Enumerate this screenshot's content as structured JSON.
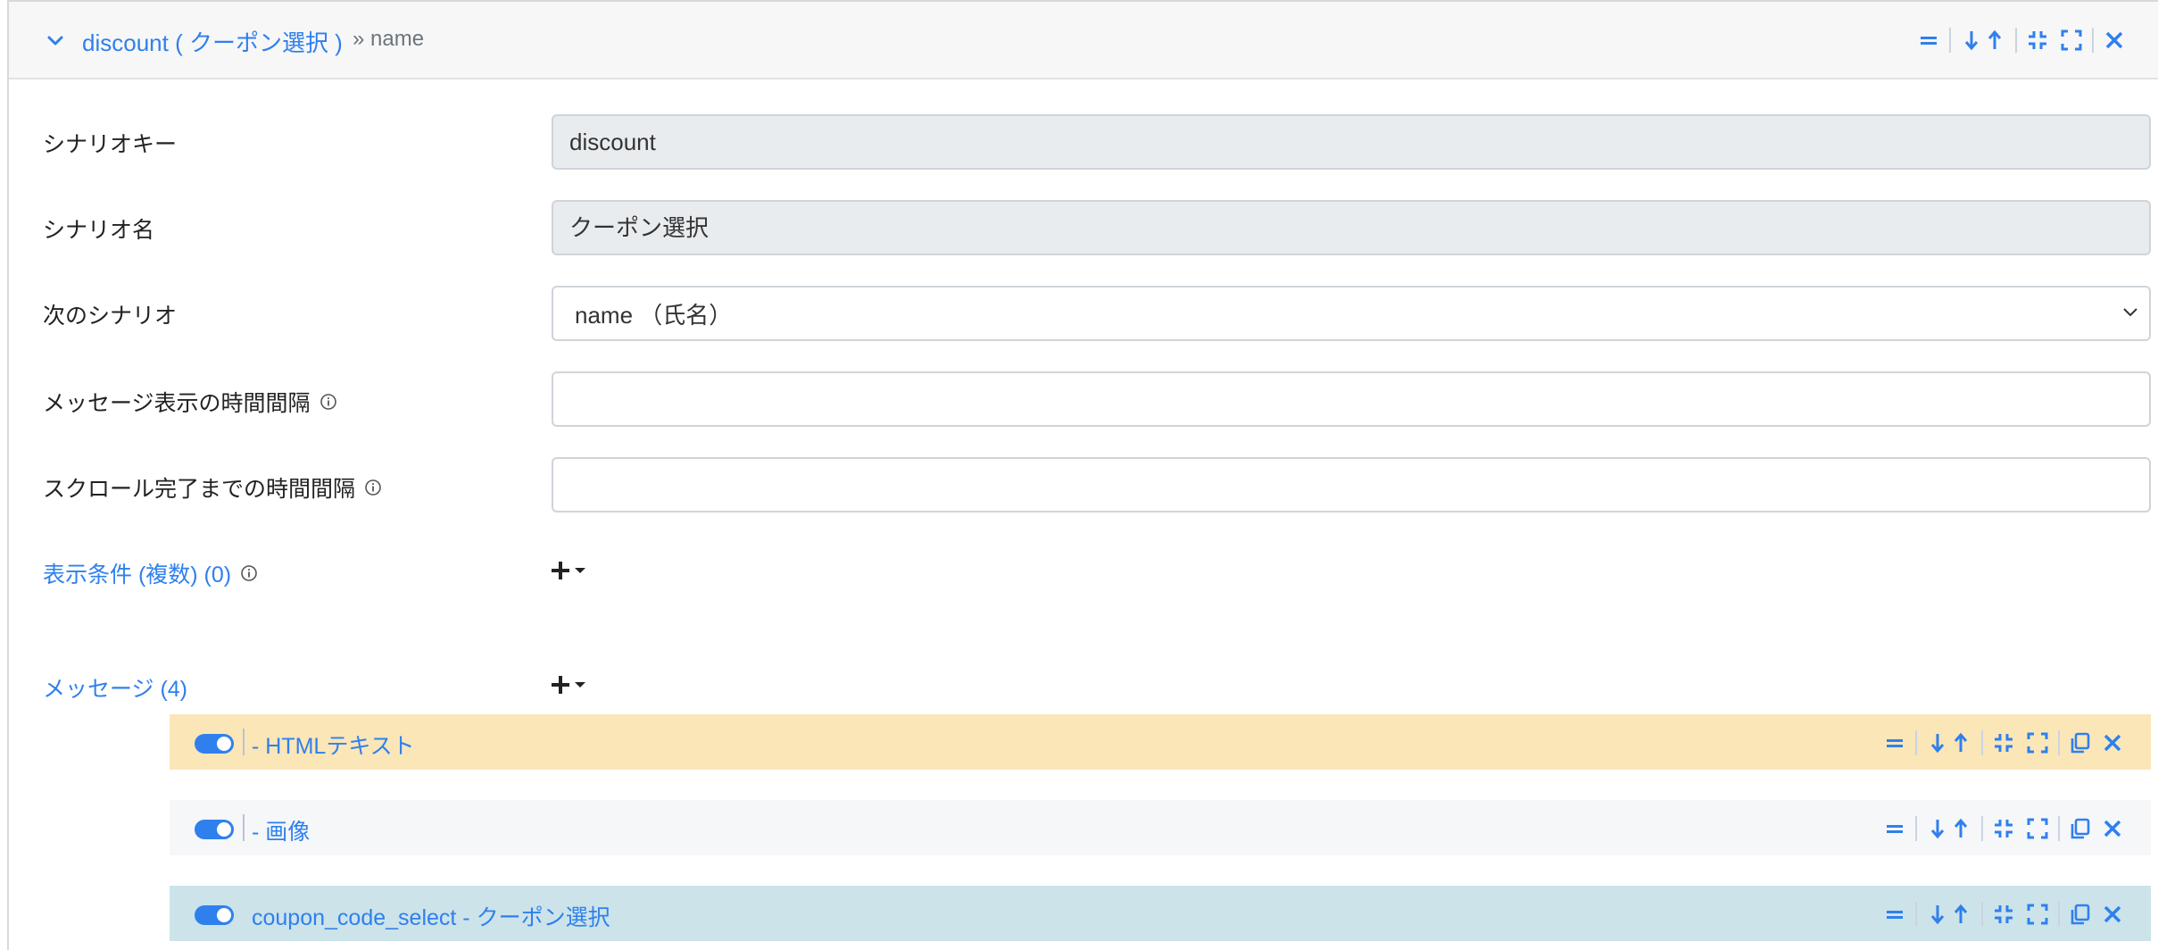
{
  "header": {
    "title": "discount ( クーポン選択 )",
    "breadcrumb": "» name"
  },
  "form": {
    "scenario_key": {
      "label": "シナリオキー",
      "value": "discount"
    },
    "scenario_name": {
      "label": "シナリオ名",
      "value": "クーポン選択"
    },
    "next_scenario": {
      "label": "次のシナリオ",
      "value": "name （氏名）"
    },
    "message_interval": {
      "label": "メッセージ表示の時間間隔",
      "value": ""
    },
    "scroll_interval": {
      "label": "スクロール完了までの時間間隔",
      "value": ""
    },
    "conditions": {
      "label": "表示条件 (複数) (0)"
    },
    "messages": {
      "label": "メッセージ (4)"
    }
  },
  "messages": [
    {
      "label": "- HTMLテキスト",
      "enabled": true,
      "color": "#fbe6b8"
    },
    {
      "label": "- 画像",
      "enabled": true,
      "color": "#f6f7f9"
    },
    {
      "label": "coupon_code_select - クーポン選択",
      "enabled": true,
      "color": "#cce3ea"
    }
  ],
  "icons": {
    "header_tools": [
      "drag-handle-icon",
      "move-down-icon",
      "move-up-icon",
      "collapse-icon",
      "expand-icon",
      "close-icon"
    ],
    "message_tools": [
      "drag-handle-icon",
      "move-down-icon",
      "move-up-icon",
      "collapse-icon",
      "expand-icon",
      "copy-icon",
      "close-icon"
    ]
  },
  "colors": {
    "accent": "#2f80ed"
  }
}
